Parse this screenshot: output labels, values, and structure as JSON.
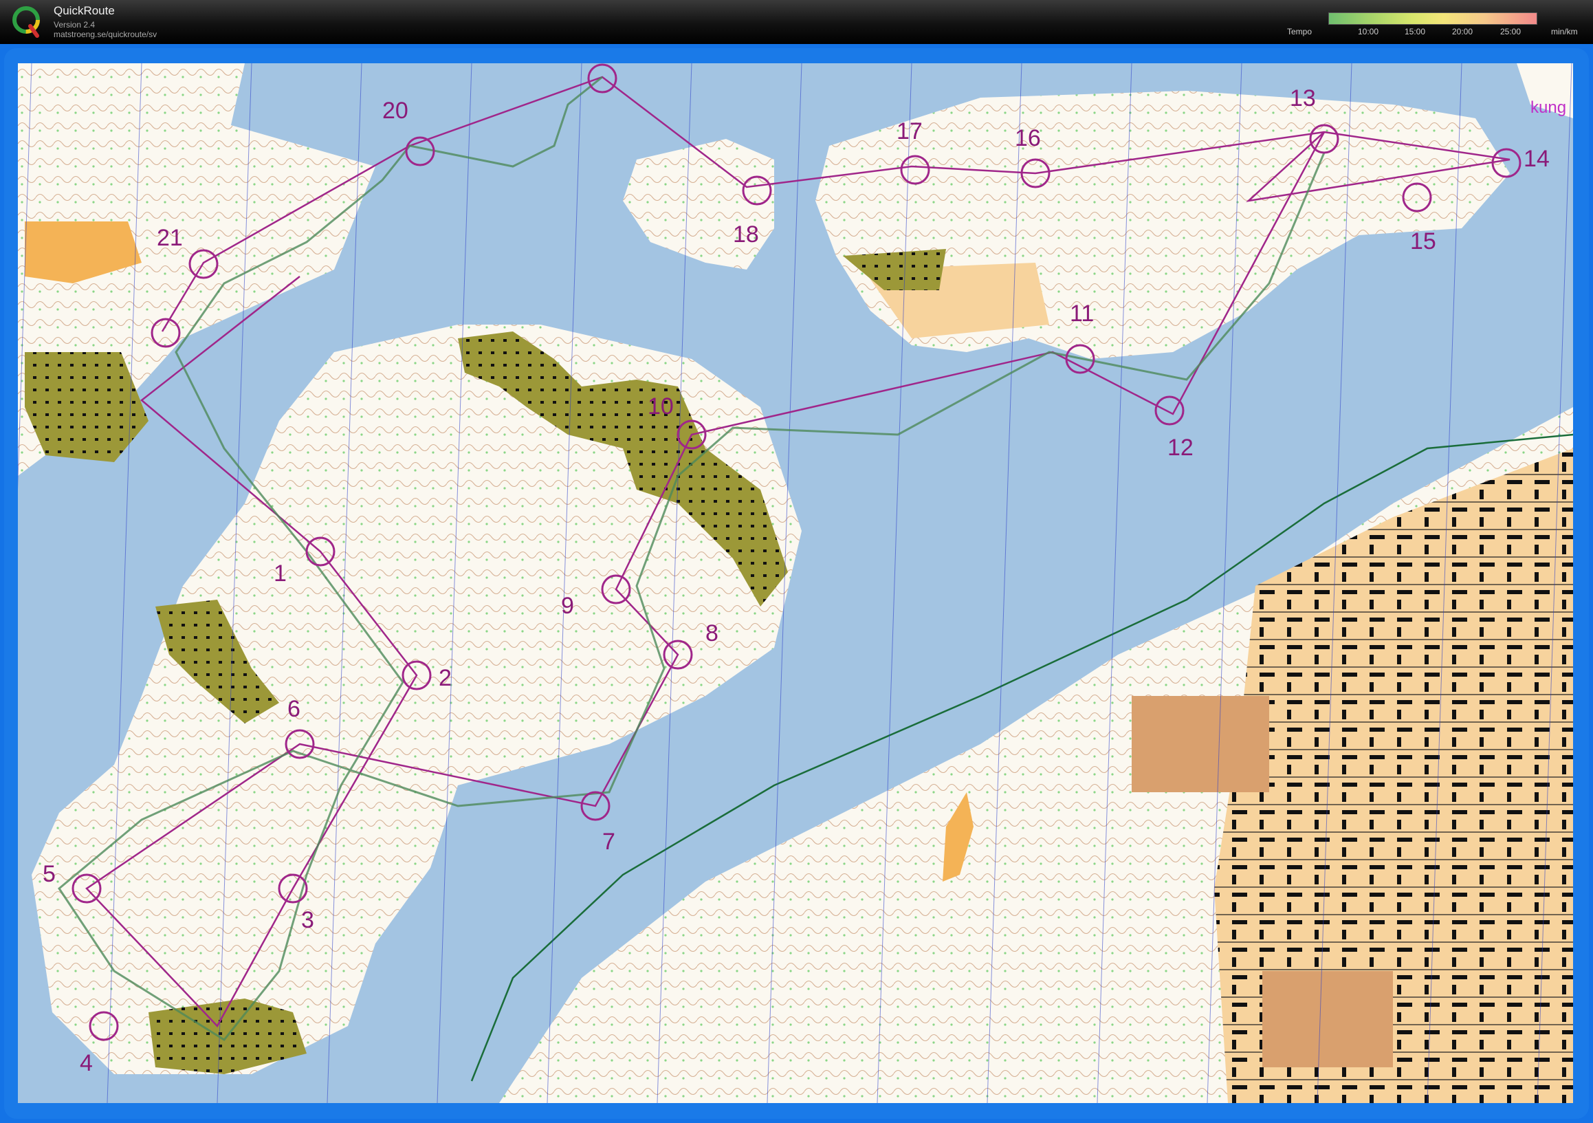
{
  "app": {
    "title": "QuickRoute",
    "version": "Version 2.4",
    "url": "matstroeng.se/quickroute/sv",
    "logo_letter": "Q"
  },
  "legend": {
    "label": "Tempo",
    "ticks": [
      "10:00",
      "15:00",
      "20:00",
      "25:00"
    ],
    "unit": "min/km"
  },
  "map": {
    "corner_label": "kung",
    "colors": {
      "water": "#a3c4e2",
      "land": "#fbf8f0",
      "open": "#f7d39d",
      "urban": "#9c9838",
      "course": "#a0268a"
    },
    "controls": [
      {
        "n": "1"
      },
      {
        "n": "2"
      },
      {
        "n": "3"
      },
      {
        "n": "4"
      },
      {
        "n": "5"
      },
      {
        "n": "6"
      },
      {
        "n": "7"
      },
      {
        "n": "8"
      },
      {
        "n": "9"
      },
      {
        "n": "10"
      },
      {
        "n": "11"
      },
      {
        "n": "12"
      },
      {
        "n": "13"
      },
      {
        "n": "14"
      },
      {
        "n": "15"
      },
      {
        "n": "16"
      },
      {
        "n": "17"
      },
      {
        "n": "18"
      },
      {
        "n": "20"
      },
      {
        "n": "21"
      }
    ]
  }
}
